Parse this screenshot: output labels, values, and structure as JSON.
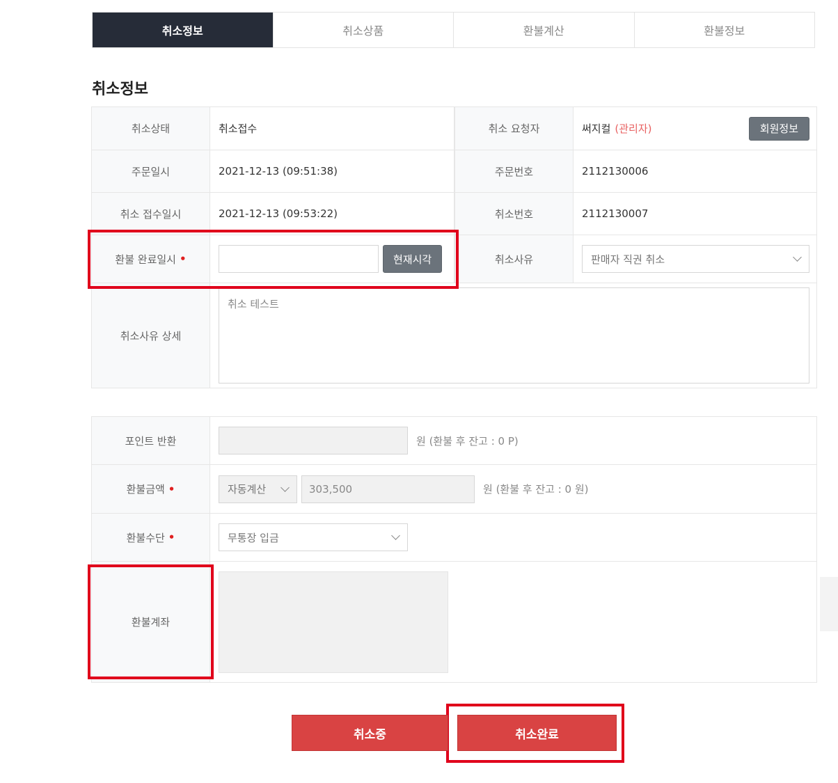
{
  "tabs": [
    {
      "label": "취소정보"
    },
    {
      "label": "취소상품"
    },
    {
      "label": "환불계산"
    },
    {
      "label": "환불정보"
    }
  ],
  "section_title": "취소정보",
  "info": {
    "status_label": "취소상태",
    "status_value": "취소접수",
    "requester_label": "취소 요청자",
    "requester_name": "써지컬",
    "requester_role": "(관리자)",
    "member_info_button": "회원정보",
    "order_date_label": "주문일시",
    "order_date_value": "2021-12-13 (09:51:38)",
    "order_no_label": "주문번호",
    "order_no_value": "2112130006",
    "cancel_date_label": "취소 접수일시",
    "cancel_date_value": "2021-12-13 (09:53:22)",
    "cancel_no_label": "취소번호",
    "cancel_no_value": "2112130007",
    "refund_done_label": "환불 완료일시",
    "refund_done_value": "",
    "now_button": "현재시각",
    "reason_label": "취소사유",
    "reason_value": "판매자 직권 취소",
    "reason_detail_label": "취소사유 상세",
    "reason_detail_value": "취소 테스트",
    "required_mark": "•"
  },
  "refund": {
    "point_label": "포인트 반환",
    "point_value": "",
    "point_note": "원 (환불 후 잔고 : 0 P)",
    "amount_label": "환불금액",
    "amount_mode": "자동계산",
    "amount_value": "303,500",
    "amount_note": "원 (환불 후 잔고 : 0 원)",
    "method_label": "환불수단",
    "method_value": "무통장 입금",
    "account_label": "환불계좌"
  },
  "actions": {
    "in_progress": "취소중",
    "complete": "취소완료"
  }
}
